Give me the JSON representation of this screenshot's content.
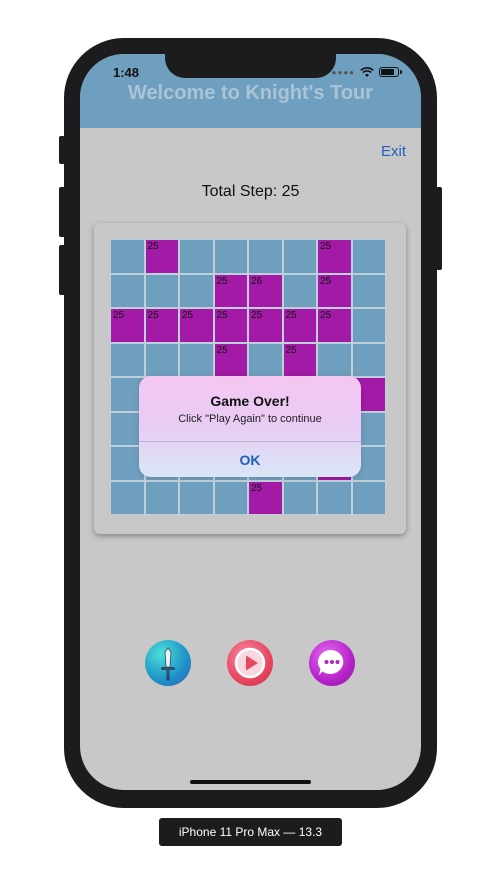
{
  "status_bar": {
    "time": "1:48"
  },
  "header": {
    "title": "Welcome to Knight's Tour"
  },
  "exit_label": "Exit",
  "total_step": "Total Step: 25",
  "board": {
    "cell_label": "25",
    "visited": [
      [
        0,
        1,
        0,
        0,
        0,
        0,
        1,
        0
      ],
      [
        0,
        0,
        0,
        1,
        1,
        0,
        1,
        0
      ],
      [
        1,
        1,
        1,
        1,
        1,
        1,
        1,
        0
      ],
      [
        0,
        0,
        0,
        1,
        0,
        1,
        0,
        0
      ],
      [
        0,
        0,
        0,
        0,
        0,
        0,
        0,
        1
      ],
      [
        0,
        0,
        0,
        0,
        0,
        0,
        0,
        0
      ],
      [
        0,
        0,
        0,
        0,
        0,
        0,
        1,
        0
      ],
      [
        0,
        0,
        0,
        0,
        1,
        0,
        0,
        0
      ]
    ],
    "labels": [
      [
        "",
        "25",
        "",
        "",
        "",
        "",
        "25",
        ""
      ],
      [
        "",
        "",
        "",
        "25",
        "26",
        "",
        "25",
        ""
      ],
      [
        "25",
        "25",
        "25",
        "25",
        "25",
        "25",
        "25",
        ""
      ],
      [
        "",
        "",
        "",
        "25",
        "",
        "25",
        "",
        ""
      ],
      [
        "",
        "",
        "",
        "",
        "",
        "",
        "",
        "5"
      ],
      [
        "",
        "",
        "",
        "",
        "",
        "",
        "",
        ""
      ],
      [
        "",
        "",
        "",
        "",
        "",
        "",
        "",
        ""
      ],
      [
        "",
        "",
        "",
        "",
        "25",
        "",
        "",
        ""
      ]
    ],
    "cell_color": "#6f9fbe",
    "visited_color": "#a31aa6"
  },
  "alert": {
    "title": "Game Over!",
    "message": "Click \"Play Again\" to continue",
    "ok_label": "OK"
  },
  "bottom_buttons": [
    {
      "icon": "sword-icon"
    },
    {
      "icon": "play-icon"
    },
    {
      "icon": "chat-icon"
    }
  ],
  "device_label": "iPhone 11 Pro Max — 13.3"
}
